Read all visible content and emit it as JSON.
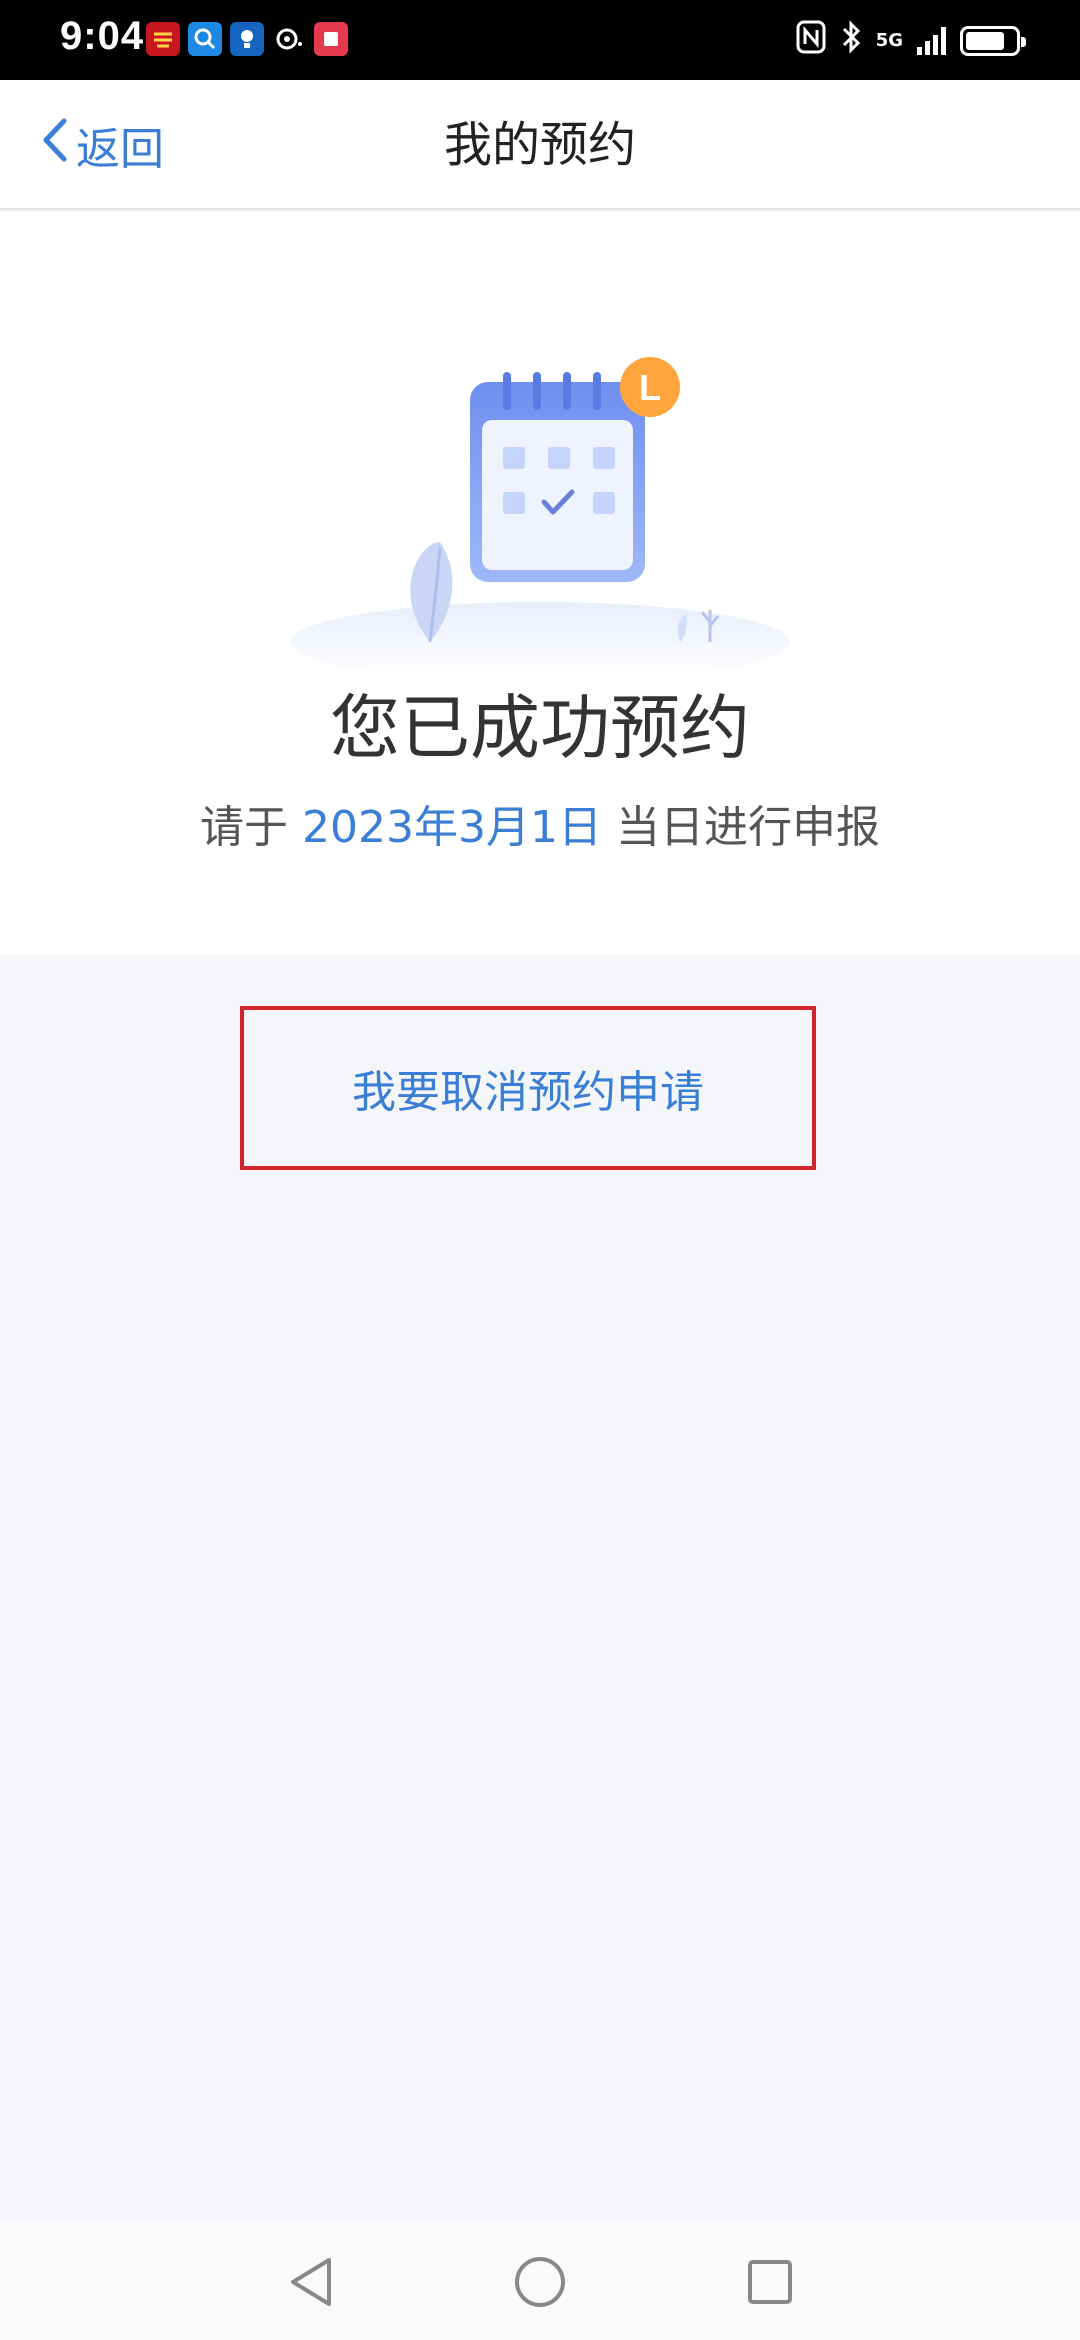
{
  "status_bar": {
    "time": "9:04",
    "network": "5G"
  },
  "header": {
    "back_label": "返回",
    "title": "我的预约"
  },
  "main": {
    "success_title": "您已成功预约",
    "subtitle_prefix": "请于",
    "subtitle_date": "2023年3月1日",
    "subtitle_suffix": "当日进行申报",
    "cancel_button_label": "我要取消预约申请",
    "calendar_badge": "L"
  },
  "colors": {
    "accent": "#3a7fd5",
    "highlight_border": "#d0242f",
    "background": "#f4f6f9"
  },
  "battery_level": 0.8,
  "icons": [
    "back-chevron-icon",
    "calendar-illustration",
    "clock-badge-icon",
    "back-triangle-icon",
    "home-circle-icon",
    "recents-square-icon"
  ]
}
